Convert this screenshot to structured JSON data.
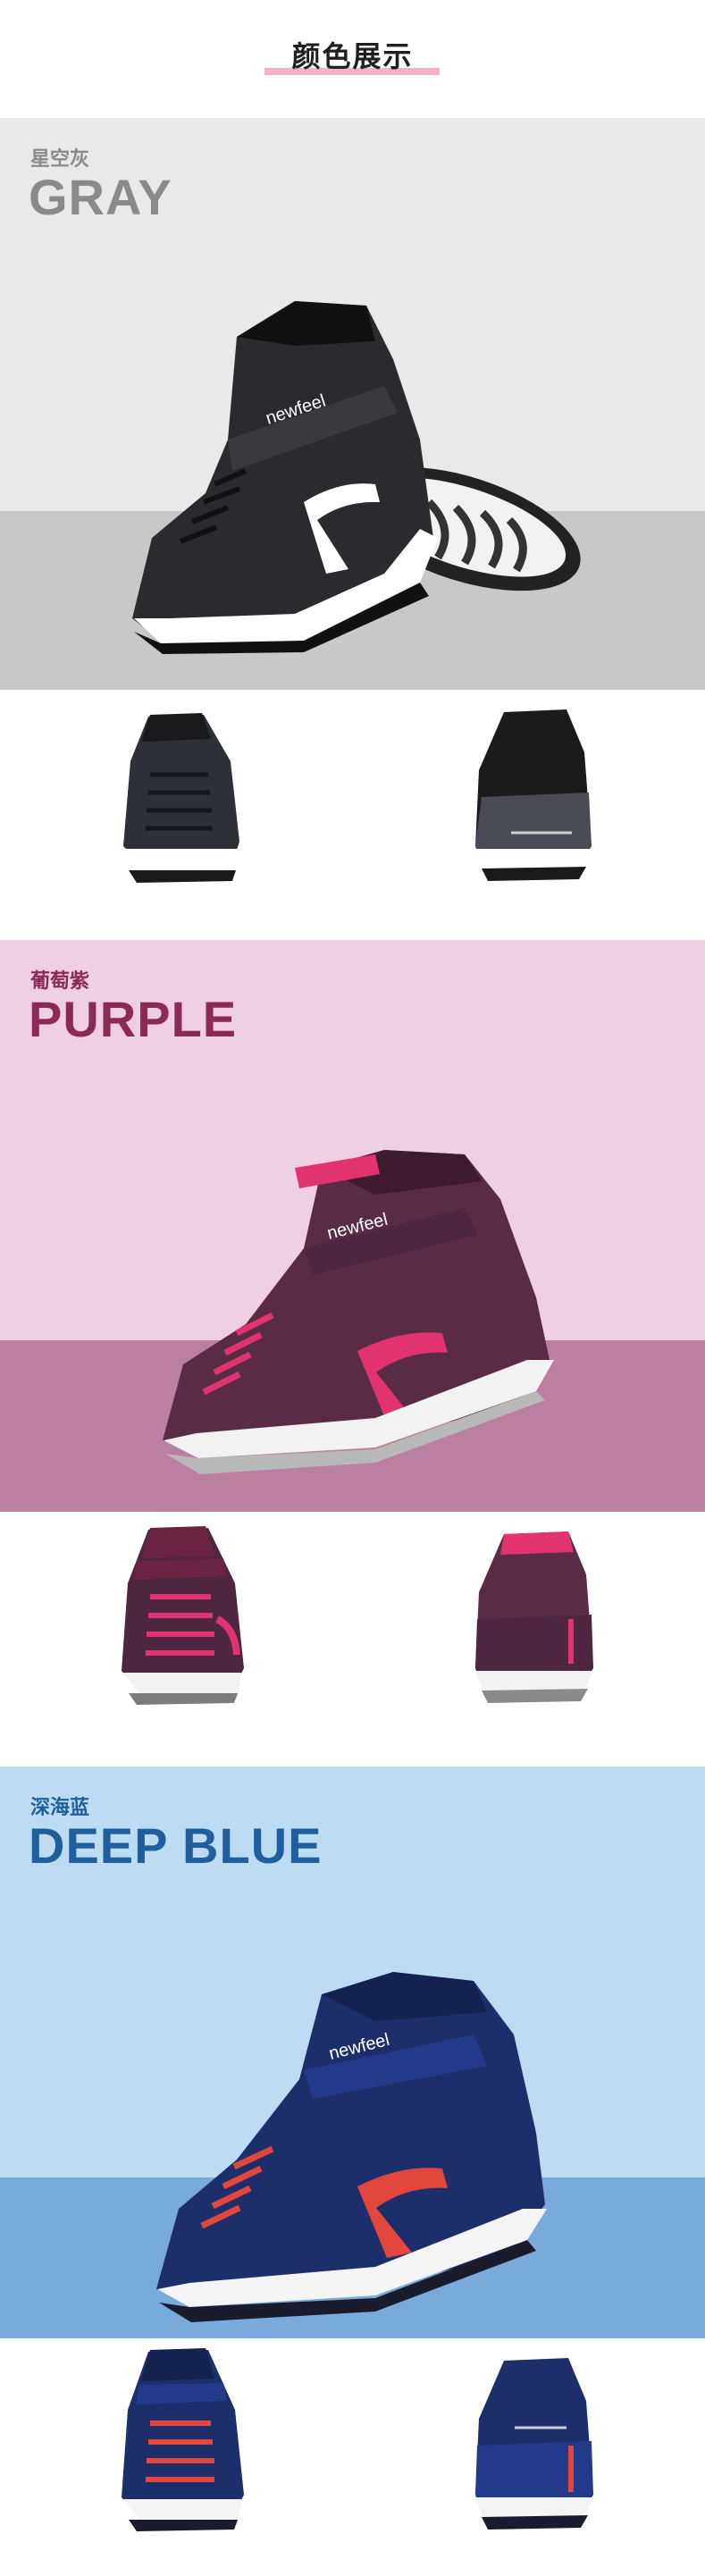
{
  "header": {
    "title": "颜色展示"
  },
  "colors": {
    "underline": "#f2b3c2",
    "gray_top": "#e9e9e9",
    "gray_bottom": "#c8c8c8",
    "purple_top": "#f1cfe3",
    "purple_bottom": "#bb7fa2",
    "blue_top": "#bddcf4",
    "blue_bottom": "#78aadc"
  },
  "variants": [
    {
      "cn": "星空灰",
      "en": "GRAY",
      "label_color": "#8a8a8a"
    },
    {
      "cn": "葡萄紫",
      "en": "PURPLE",
      "label_color": "#8b2a57"
    },
    {
      "cn": "深海蓝",
      "en": "DEEP BLUE",
      "label_color": "#1f5f9e"
    }
  ],
  "brand": "newfeel"
}
